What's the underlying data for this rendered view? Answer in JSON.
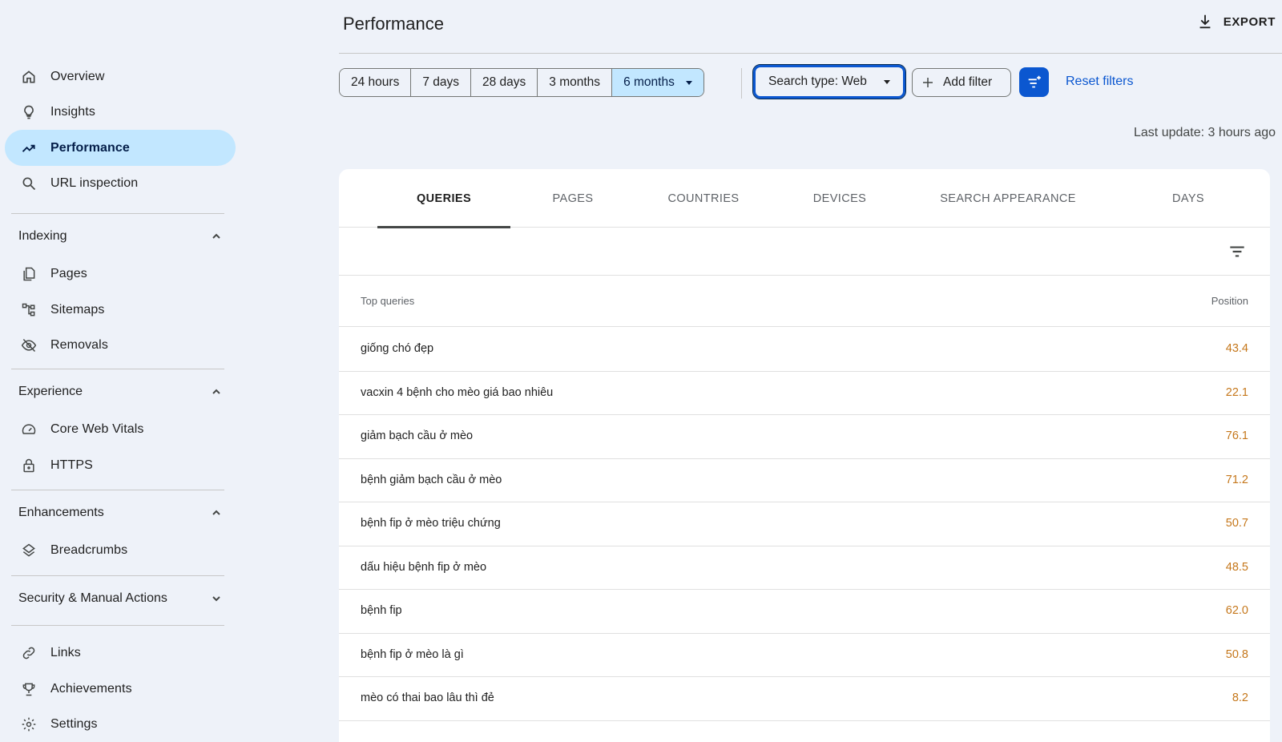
{
  "sidebar": {
    "nav": [
      {
        "label": "Overview",
        "icon": "home-icon"
      },
      {
        "label": "Insights",
        "icon": "lightbulb-icon"
      },
      {
        "label": "Performance",
        "icon": "trending-up-icon",
        "active": true
      },
      {
        "label": "URL inspection",
        "icon": "search-icon"
      }
    ],
    "indexing": {
      "title": "Indexing",
      "items": [
        {
          "label": "Pages",
          "icon": "pages-icon"
        },
        {
          "label": "Sitemaps",
          "icon": "sitemap-icon"
        },
        {
          "label": "Removals",
          "icon": "eye-off-icon"
        }
      ]
    },
    "experience": {
      "title": "Experience",
      "items": [
        {
          "label": "Core Web Vitals",
          "icon": "speedometer-icon"
        },
        {
          "label": "HTTPS",
          "icon": "lock-icon"
        }
      ]
    },
    "enhancements": {
      "title": "Enhancements",
      "items": [
        {
          "label": "Breadcrumbs",
          "icon": "layers-icon"
        }
      ]
    },
    "security": {
      "title": "Security & Manual Actions"
    },
    "bottom": [
      {
        "label": "Links",
        "icon": "link-icon"
      },
      {
        "label": "Achievements",
        "icon": "trophy-icon"
      },
      {
        "label": "Settings",
        "icon": "gear-icon"
      }
    ]
  },
  "header": {
    "title": "Performance",
    "export_label": "EXPORT"
  },
  "filters": {
    "ranges": [
      "24 hours",
      "7 days",
      "28 days",
      "3 months",
      "6 months"
    ],
    "selected_range": "6 months",
    "search_type": "Search type: Web",
    "add_filter": "Add filter",
    "reset": "Reset filters",
    "last_update": "Last update: 3 hours ago"
  },
  "tabs": [
    "QUERIES",
    "PAGES",
    "COUNTRIES",
    "DEVICES",
    "SEARCH APPEARANCE",
    "DAYS"
  ],
  "active_tab": "QUERIES",
  "table": {
    "col_query": "Top queries",
    "col_position": "Position",
    "rows": [
      {
        "query": "giống chó đẹp",
        "position": "43.4"
      },
      {
        "query": "vacxin 4 bệnh cho mèo giá bao nhiêu",
        "position": "22.1"
      },
      {
        "query": "giảm bạch cầu ở mèo",
        "position": "76.1"
      },
      {
        "query": "bệnh giảm bạch cầu ở mèo",
        "position": "71.2"
      },
      {
        "query": "bệnh fip ở mèo triệu chứng",
        "position": "50.7"
      },
      {
        "query": "dấu hiệu bệnh fip ở mèo",
        "position": "48.5"
      },
      {
        "query": "bệnh fip",
        "position": "62.0"
      },
      {
        "query": "bệnh fip ở mèo là gì",
        "position": "50.8"
      },
      {
        "query": "mèo có thai bao lâu thì đẻ",
        "position": "8.2"
      }
    ]
  },
  "colors": {
    "background": "#eef2f9",
    "active_nav": "#c2e7ff",
    "accent": "#0b57d0",
    "position_value": "#c5771b"
  }
}
